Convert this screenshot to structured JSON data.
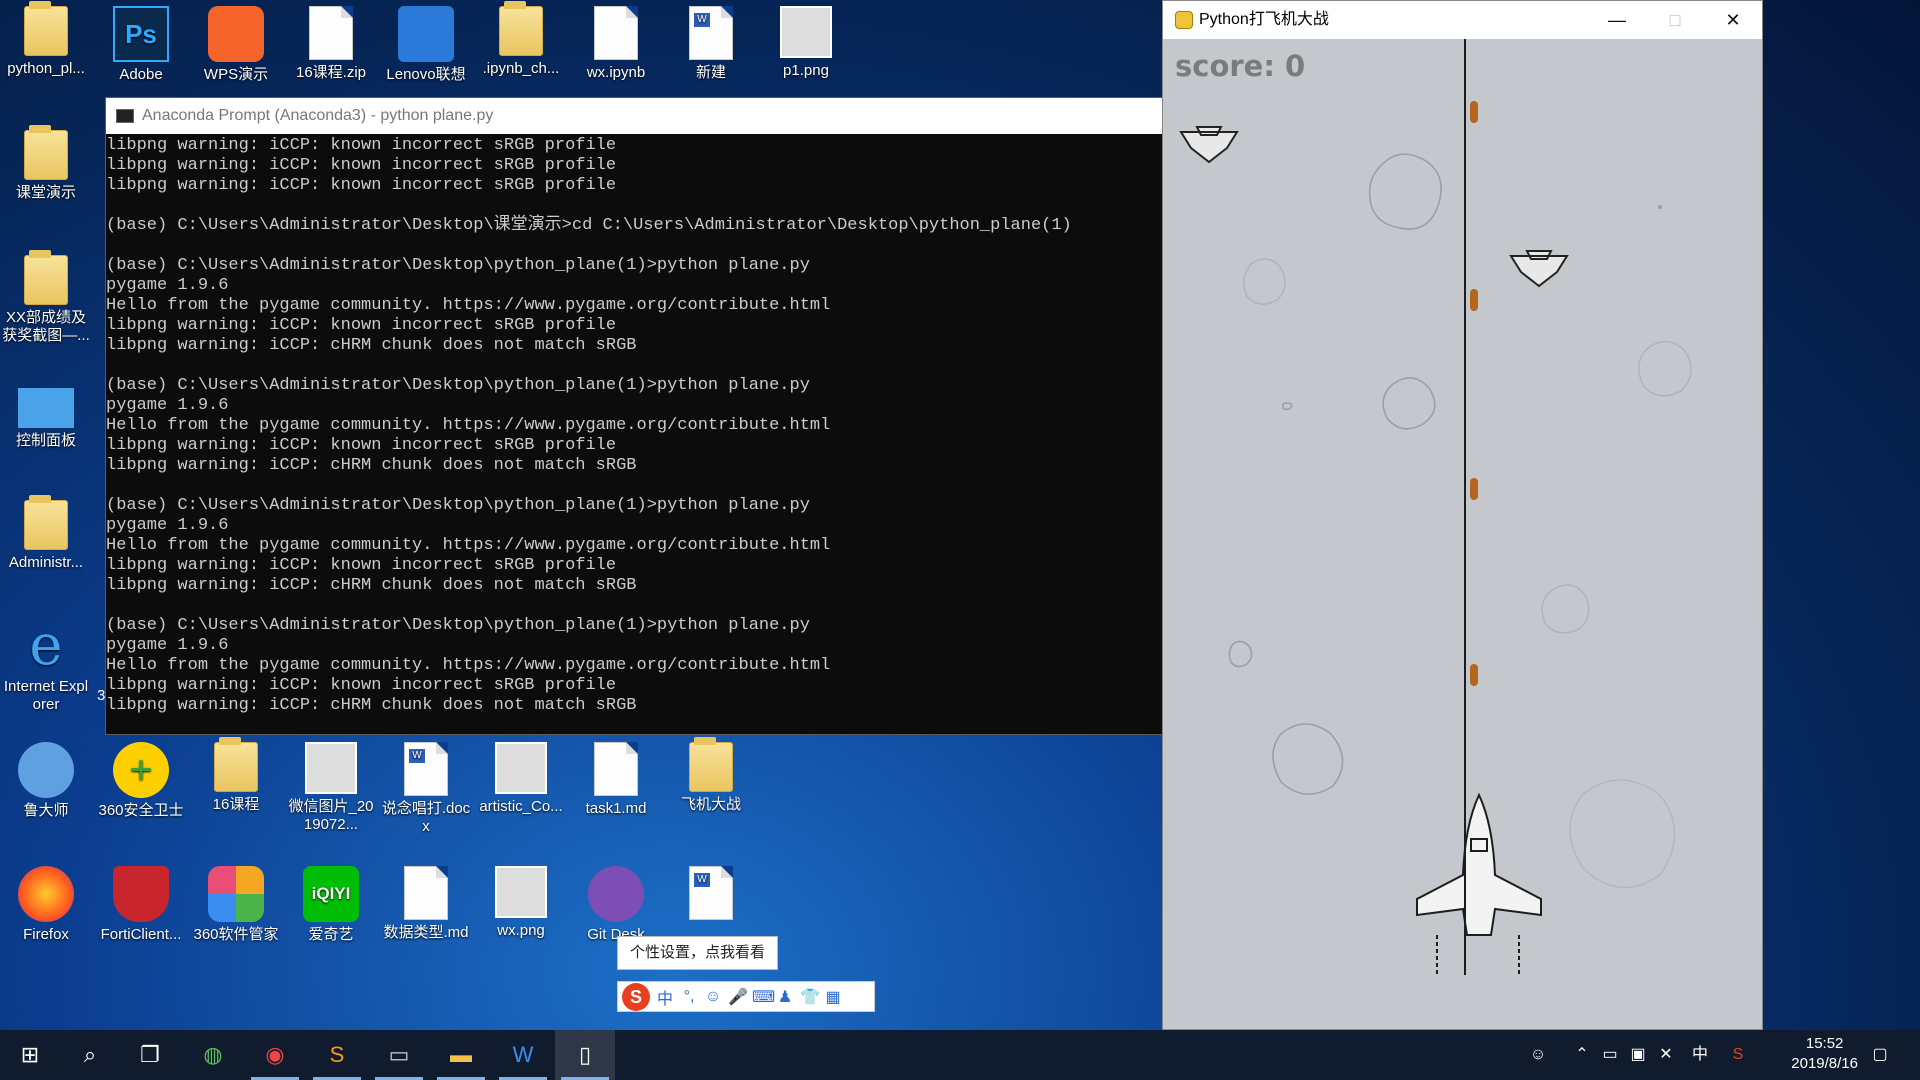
{
  "desktop": {
    "row1": [
      {
        "label": "python_pl...",
        "icon": "folder-icon"
      },
      {
        "label": "Adobe",
        "icon": "photoshop-icon"
      },
      {
        "label": "WPS演示",
        "icon": "wps-presentation-icon"
      },
      {
        "label": "16课程.zip",
        "icon": "zip-file-icon"
      },
      {
        "label": "Lenovo联想",
        "icon": "lenovo-manager-icon"
      },
      {
        "label": ".ipynb_ch...",
        "icon": "folder-icon"
      },
      {
        "label": "wx.ipynb",
        "icon": "file-icon"
      },
      {
        "label": "新建",
        "icon": "word-doc-icon"
      },
      {
        "label": "p1.png",
        "icon": "image-file-icon"
      }
    ],
    "column": [
      {
        "label": "课堂演示",
        "icon": "folder-icon"
      },
      {
        "label": "XX部成绩及获奖截图—...",
        "icon": "folder-icon"
      },
      {
        "label": "控制面板",
        "icon": "control-panel-icon"
      },
      {
        "label": "Administr...",
        "icon": "user-folder-icon"
      },
      {
        "label": "Internet Explorer",
        "icon": "ie-icon"
      }
    ],
    "row_lower": [
      {
        "label": "鲁大师",
        "icon": "ludashi-icon"
      },
      {
        "label": "360安全卫士",
        "icon": "360-security-icon"
      },
      {
        "label": "16课程",
        "icon": "folder-icon"
      },
      {
        "label": "微信图片_2019072...",
        "icon": "image-file-icon"
      },
      {
        "label": "说念唱打.docx",
        "icon": "word-doc-icon"
      },
      {
        "label": "artistic_Co...",
        "icon": "image-file-icon"
      },
      {
        "label": "task1.md",
        "icon": "file-icon"
      },
      {
        "label": "飞机大战",
        "icon": "folder-icon"
      }
    ],
    "row_bottom": [
      {
        "label": "Firefox",
        "icon": "firefox-icon"
      },
      {
        "label": "FortiClient...",
        "icon": "forticlient-icon"
      },
      {
        "label": "360软件管家",
        "icon": "360-software-icon"
      },
      {
        "label": "爱奇艺",
        "icon": "iqiyi-icon"
      },
      {
        "label": "数据类型.md",
        "icon": "file-icon"
      },
      {
        "label": "wx.png",
        "icon": "image-file-icon"
      },
      {
        "label": "Git Desk",
        "icon": "github-icon"
      },
      {
        "label": "",
        "icon": "word-doc-icon"
      }
    ],
    "stray_char": "3"
  },
  "terminal": {
    "title": "Anaconda Prompt (Anaconda3) - python  plane.py",
    "lines": [
      "libpng warning: iCCP: known incorrect sRGB profile",
      "libpng warning: iCCP: known incorrect sRGB profile",
      "libpng warning: iCCP: known incorrect sRGB profile",
      "",
      "(base) C:\\Users\\Administrator\\Desktop\\课堂演示>cd C:\\Users\\Administrator\\Desktop\\python_plane(1)",
      "",
      "(base) C:\\Users\\Administrator\\Desktop\\python_plane(1)>python plane.py",
      "pygame 1.9.6",
      "Hello from the pygame community. https://www.pygame.org/contribute.html",
      "libpng warning: iCCP: known incorrect sRGB profile",
      "libpng warning: iCCP: cHRM chunk does not match sRGB",
      "",
      "(base) C:\\Users\\Administrator\\Desktop\\python_plane(1)>python plane.py",
      "pygame 1.9.6",
      "Hello from the pygame community. https://www.pygame.org/contribute.html",
      "libpng warning: iCCP: known incorrect sRGB profile",
      "libpng warning: iCCP: cHRM chunk does not match sRGB",
      "",
      "(base) C:\\Users\\Administrator\\Desktop\\python_plane(1)>python plane.py",
      "pygame 1.9.6",
      "Hello from the pygame community. https://www.pygame.org/contribute.html",
      "libpng warning: iCCP: known incorrect sRGB profile",
      "libpng warning: iCCP: cHRM chunk does not match sRGB",
      "",
      "(base) C:\\Users\\Administrator\\Desktop\\python_plane(1)>python plane.py",
      "pygame 1.9.6",
      "Hello from the pygame community. https://www.pygame.org/contribute.html",
      "libpng warning: iCCP: known incorrect sRGB profile",
      "libpng warning: iCCP: cHRM chunk does not match sRGB"
    ]
  },
  "game": {
    "title": "Python打飞机大战",
    "score_text": "score: 0",
    "background_color": "#c4c7cb"
  },
  "ime": {
    "tooltip": "个性设置，点我看看",
    "mode": "中"
  },
  "taskbar": {
    "time": "15:52",
    "date": "2019/8/16",
    "input_lang": "中"
  }
}
